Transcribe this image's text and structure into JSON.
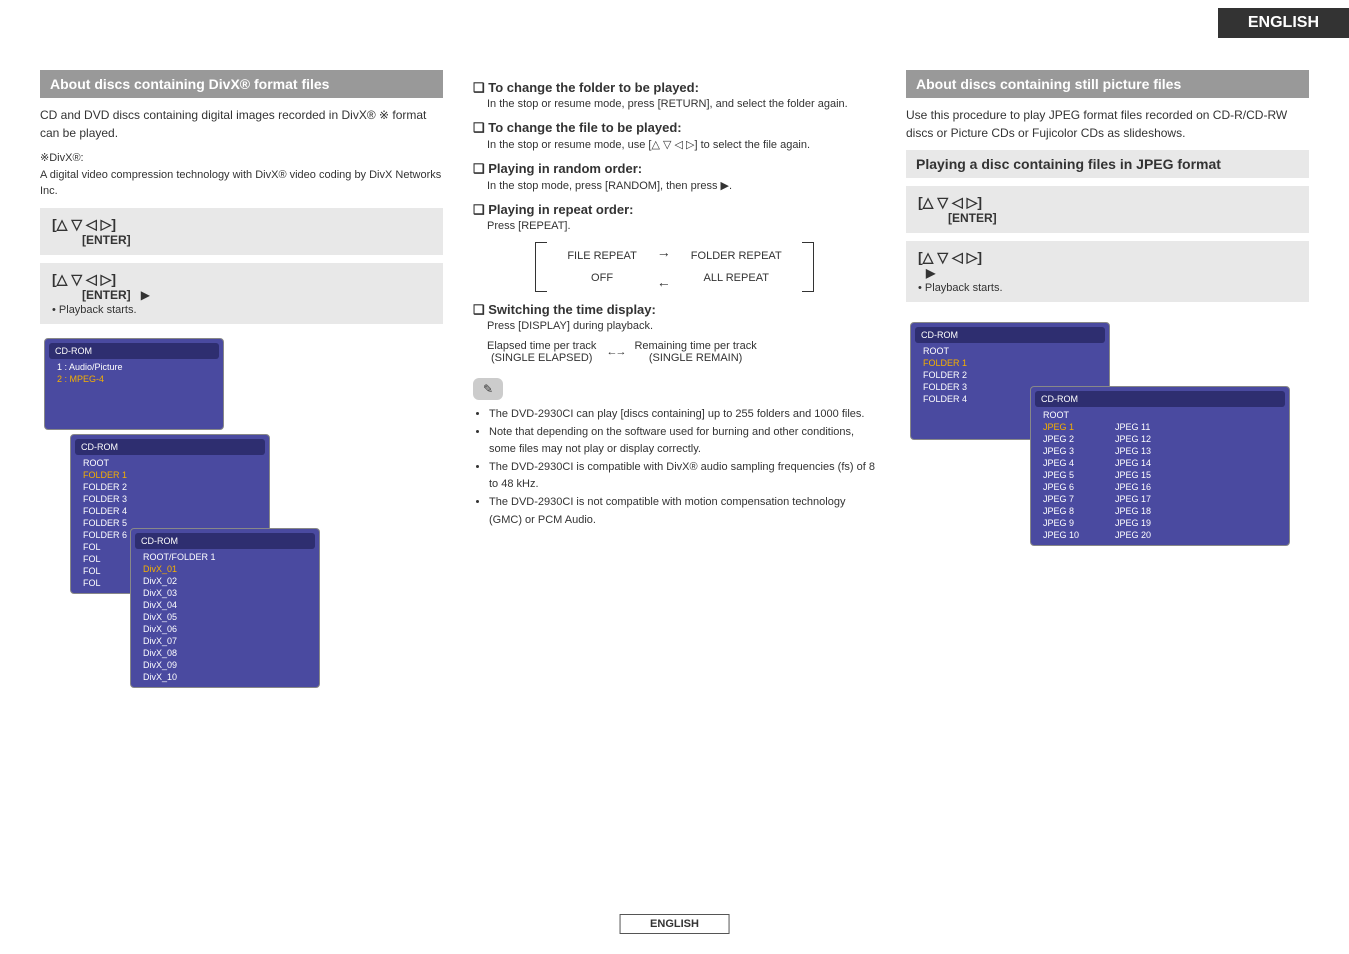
{
  "doc": {
    "lang_tab": "ENGLISH",
    "footer_lang": "ENGLISH"
  },
  "col1": {
    "heading": "About discs containing DivX® format files",
    "body1": "CD and DVD discs containing digital images recorded in DivX® ※ format can be played.",
    "note_label": "※DivX®:",
    "note_body": "A digital video compression technology with DivX® video coding by DivX Networks Inc.",
    "step1_symbols": "[△ ▽ ◁ ▷]",
    "step1_enter": "[ENTER]",
    "step2_symbols": "[△ ▽ ◁ ▷]",
    "step2_enter": "[ENTER]",
    "step2_play": "▶",
    "step2_bullet": "• Playback starts.",
    "mock1": {
      "title": "CD-ROM",
      "line1": "1 : Audio/Picture",
      "line2_sel": "2 : MPEG-4"
    },
    "mock2": {
      "title": "CD-ROM",
      "root": "ROOT",
      "folders": [
        "FOLDER 1",
        "FOLDER 2",
        "FOLDER 3",
        "FOLDER 4",
        "FOLDER 5",
        "FOLDER 6",
        "FOL",
        "FOL",
        "FOL",
        "FOL"
      ]
    },
    "mock3": {
      "title": "CD-ROM",
      "root": "ROOT/FOLDER 1",
      "files": [
        "DivX_01",
        "DivX_02",
        "DivX_03",
        "DivX_04",
        "DivX_05",
        "DivX_06",
        "DivX_07",
        "DivX_08",
        "DivX_09",
        "DivX_10"
      ]
    }
  },
  "col2": {
    "h_folder": "❏ To change the folder to be played:",
    "p_folder": "In the stop or resume mode, press [RETURN], and select the folder again.",
    "h_file": "❏ To change the file to be played:",
    "p_file": "In the stop or resume mode, use [△ ▽ ◁ ▷] to select the file again.",
    "h_random": "❏ Playing in random order:",
    "p_random": "In the stop mode, press [RANDOM], then press ▶.",
    "h_repeat": "❏ Playing in repeat order:",
    "p_repeat": "Press [REPEAT].",
    "repeat_labels": {
      "file": "FILE REPEAT",
      "folder": "FOLDER REPEAT",
      "off": "OFF",
      "all": "ALL REPEAT"
    },
    "h_time": "❏ Switching the time display:",
    "p_time": "Press [DISPLAY] during playback.",
    "time_left_top": "Elapsed time per track",
    "time_left_bot": "(SINGLE ELAPSED)",
    "time_right_top": "Remaining time per track",
    "time_right_bot": "(SINGLE REMAIN)",
    "pencil": "✎",
    "notes": [
      "The DVD-2930CI can play [discs containing] up to 255 folders and 1000 files.",
      "Note that depending on the software used for burning and other conditions, some files may not play or display correctly.",
      "The DVD-2930CI is compatible with DivX® audio sampling frequencies (fs) of 8 to 48 kHz.",
      "The DVD-2930CI is not compatible with motion compensation technology (GMC) or PCM Audio."
    ]
  },
  "col3": {
    "heading1": "About discs containing still picture files",
    "body1": "Use this procedure to play JPEG format files recorded on CD-R/CD-RW discs or Picture CDs or Fujicolor CDs as slideshows.",
    "heading2": "Playing a disc containing files in JPEG format",
    "step1_symbols": "[△ ▽ ◁ ▷]",
    "step1_enter": "[ENTER]",
    "step2_symbols": "[△ ▽ ◁ ▷]",
    "step2_play": "▶",
    "step2_bullet": "• Playback starts.",
    "mockA": {
      "title": "CD-ROM",
      "root": "ROOT",
      "folders": [
        "FOLDER 1",
        "FOLDER 2",
        "FOLDER 3",
        "FOLDER 4"
      ]
    },
    "mockB": {
      "title": "CD-ROM",
      "root": "ROOT",
      "left": [
        "JPEG 1",
        "JPEG 2",
        "JPEG 3",
        "JPEG 4",
        "JPEG 5",
        "JPEG 6",
        "JPEG 7",
        "JPEG 8",
        "JPEG 9",
        "JPEG 10"
      ],
      "right": [
        "JPEG 11",
        "JPEG 12",
        "JPEG 13",
        "JPEG 14",
        "JPEG 15",
        "JPEG 16",
        "JPEG 17",
        "JPEG 18",
        "JPEG 19",
        "JPEG 20"
      ]
    }
  }
}
